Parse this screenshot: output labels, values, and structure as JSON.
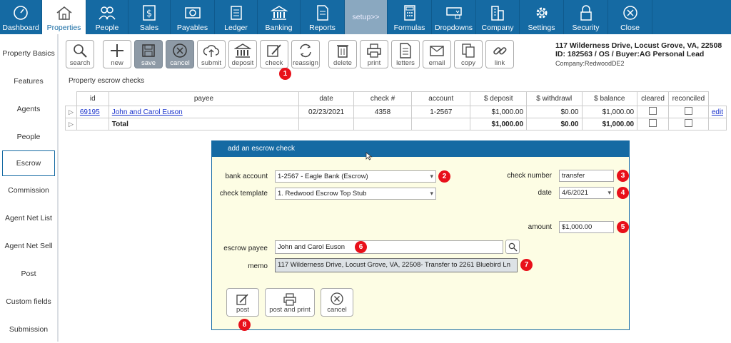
{
  "nav": {
    "items": [
      {
        "label": "Dashboard",
        "icon": "dashboard-gauge-icon"
      },
      {
        "label": "Properties",
        "icon": "house-icon"
      },
      {
        "label": "People",
        "icon": "people-icon"
      },
      {
        "label": "Sales",
        "icon": "dollar-icon"
      },
      {
        "label": "Payables",
        "icon": "money-icon"
      },
      {
        "label": "Ledger",
        "icon": "ledger-book-icon"
      },
      {
        "label": "Banking",
        "icon": "bank-icon"
      },
      {
        "label": "Reports",
        "icon": "report-icon"
      },
      {
        "label": "setup>>",
        "icon": ""
      },
      {
        "label": "Formulas",
        "icon": "calculator-icon"
      },
      {
        "label": "Dropdowns",
        "icon": "dropdown-icon"
      },
      {
        "label": "Company",
        "icon": "building-icon"
      },
      {
        "label": "Settings",
        "icon": "gear-icon"
      },
      {
        "label": "Security",
        "icon": "lock-icon"
      },
      {
        "label": "Close",
        "icon": "close-icon"
      }
    ]
  },
  "sidebar": {
    "items": [
      "Property Basics",
      "Features",
      "Agents",
      "People",
      "Escrow",
      "Commission",
      "Agent Net List",
      "Agent Net Sell",
      "Post",
      "Custom fields",
      "Submission"
    ]
  },
  "toolbar": {
    "search": "search",
    "new": "new",
    "save": "save",
    "cancel": "cancel",
    "submit": "submit",
    "deposit": "deposit",
    "check": "check",
    "reassign": "reassign",
    "delete": "delete",
    "print": "print",
    "letters": "letters",
    "email": "email",
    "copy": "copy",
    "link": "link"
  },
  "property": {
    "address": "117 Wilderness Drive, Locust Grove, VA, 22508",
    "id_line": "ID: 182563 / OS / Buyer:AG Personal Lead",
    "company": "Company:RedwoodDE2"
  },
  "section_title": "Property escrow checks",
  "table": {
    "headers": [
      "id",
      "payee",
      "date",
      "check #",
      "account",
      "$ deposit",
      "$ withdrawl",
      "$ balance",
      "cleared",
      "reconciled"
    ],
    "row": {
      "id": "69195",
      "payee": "John and Carol  Euson",
      "date": "02/23/2021",
      "check": "4358",
      "account": "1-2567",
      "deposit": "$1,000.00",
      "withdrawl": "$0.00",
      "balance": "$1,000.00",
      "edit": "edit"
    },
    "total": {
      "label": "Total",
      "deposit": "$1,000.00",
      "withdrawl": "$0.00",
      "balance": "$1,000.00"
    }
  },
  "dialog": {
    "title": "add an escrow check",
    "bank_account_label": "bank account",
    "bank_account": "1-2567 - Eagle Bank (Escrow)",
    "check_template_label": "check template",
    "check_template": "1. Redwood Escrow Top Stub",
    "check_number_label": "check number",
    "check_number": "transfer",
    "date_label": "date",
    "date": "4/6/2021",
    "amount_label": "amount",
    "amount": "$1,000.00",
    "payee_label": "escrow payee",
    "payee": "John and Carol  Euson",
    "memo_label": "memo",
    "memo": "117 Wilderness Drive, Locust Grove, VA, 22508- Transfer to 2261 Bluebird Ln",
    "post": "post",
    "post_print": "post and print",
    "cancel": "cancel"
  },
  "badges": [
    "1",
    "2",
    "3",
    "4",
    "5",
    "6",
    "7",
    "8"
  ],
  "colors": {
    "nav": "#156aa3",
    "badge": "#e8101a",
    "dialog_bg": "#fdfde4"
  }
}
